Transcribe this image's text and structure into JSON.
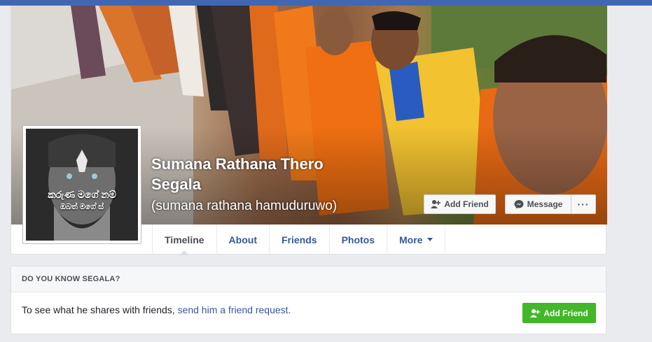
{
  "profile": {
    "name_line1": "Sumana Rathana Thero",
    "name_line2": "Segala",
    "alternate_name": "(sumana rathana hamuduruwo)",
    "avatar_caption_line1": "කරුණ මගේ නම්",
    "avatar_caption_line2": "ඔබත් මගේ ස්"
  },
  "cover_actions": {
    "add_friend": "Add Friend",
    "message": "Message",
    "more": "···"
  },
  "tabs": [
    {
      "label": "Timeline"
    },
    {
      "label": "About"
    },
    {
      "label": "Friends"
    },
    {
      "label": "Photos"
    },
    {
      "label": "More"
    }
  ],
  "know_card": {
    "header": "DO YOU KNOW SEGALA?",
    "body_text": "To see what he shares with friends, ",
    "link_text": "send him a friend request.",
    "button": "Add Friend"
  },
  "colors": {
    "topbar": "#4267b2",
    "link": "#365899",
    "green_button": "#42b72a",
    "page_bg": "#e9ebee"
  },
  "icons": [
    "add-friend-icon",
    "messenger-icon",
    "more-dots-icon",
    "caret-down-icon"
  ]
}
